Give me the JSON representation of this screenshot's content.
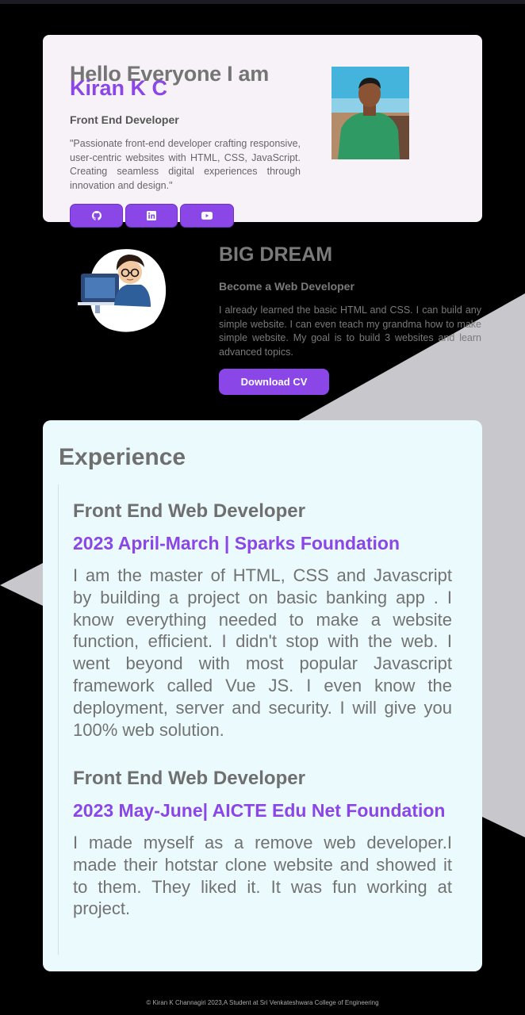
{
  "hero": {
    "greeting": "Hello Everyone I am",
    "name": "Kiran K C",
    "role": "Front End Developer",
    "quote": "\"Passionate front-end developer crafting responsive, user-centric websites with HTML, CSS, JavaScript. Creating seamless digital experiences through innovation and design.\"",
    "social": [
      {
        "icon": "github-icon"
      },
      {
        "icon": "linkedin-icon"
      },
      {
        "icon": "youtube-icon"
      }
    ]
  },
  "dream": {
    "title": "BIG DREAM",
    "subtitle": "Become a Web Developer",
    "text": "I already learned the basic HTML and CSS. I can build any simple website. I can even teach my grandma how to make simple website. My goal is to build 3 websites and learn advanced topics.",
    "cv_button": "Download CV"
  },
  "experience": {
    "heading": "Experience",
    "jobs": [
      {
        "title": "Front End Web Developer",
        "period": "2023 April-March | Sparks Foundation",
        "description": "I am the master of HTML, CSS and Javascript by building a project on basic banking app . I know everything needed to make a website function, efficient. I didn't stop with the web. I went beyond with most popular Javascript framework called Vue JS. I even know the deployment, server and security. I will give you 100% web solution."
      },
      {
        "title": "Front End Web Developer",
        "period": "2023 May-June| AICTE Edu Net Foundation",
        "description": "I made myself as a remove web developer.I made their hotstar clone website and showed it to them. They liked it. It was fun working at project."
      }
    ]
  },
  "footer": "© Kiran K Channagiri 2023,A Student at Sri Venkateshwara College of Engineering",
  "colors": {
    "accent": "#8a46e6",
    "background": "#000000",
    "hero_card": "#f7f2f8",
    "experience_card": "#ebfbfd",
    "bg_shape": "#c8c7cc"
  }
}
